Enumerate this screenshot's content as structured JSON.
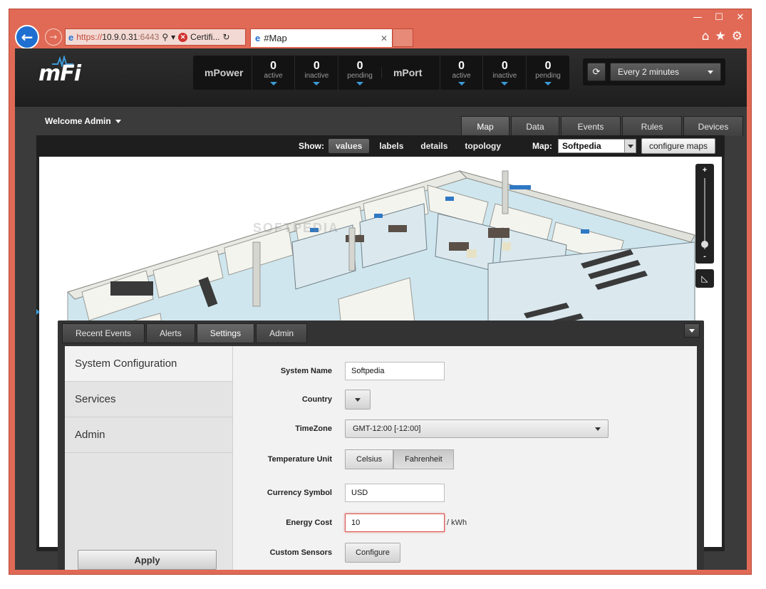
{
  "window": {
    "controls": [
      "—",
      "☐",
      "✕"
    ]
  },
  "browser": {
    "back_icon": "←",
    "forward_icon": "→",
    "address": {
      "ie_icon": "e",
      "url_https": "https://",
      "url_main": "10.9.0.31",
      "url_port": ":6443",
      "search_icon": "⚲",
      "dropdown_icon": "▾",
      "cert_icon": "✕",
      "cert_text": "Certifi...",
      "reload_icon": "↻"
    },
    "tab": {
      "ie_icon": "e",
      "title": "#Map",
      "close": "✕"
    },
    "tools": {
      "home": "⌂",
      "favorites": "★",
      "settings": "⚙"
    }
  },
  "header": {
    "logo": "mFi",
    "mpower": {
      "title": "mPower",
      "stats": [
        {
          "value": "0",
          "label": "active"
        },
        {
          "value": "0",
          "label": "inactive"
        },
        {
          "value": "0",
          "label": "pending"
        }
      ]
    },
    "mport": {
      "title": "mPort",
      "stats": [
        {
          "value": "0",
          "label": "active"
        },
        {
          "value": "0",
          "label": "inactive"
        },
        {
          "value": "0",
          "label": "pending"
        }
      ]
    },
    "refresh_icon": "⟳",
    "refresh_interval": "Every 2 minutes"
  },
  "welcome": "Welcome Admin",
  "nav_tabs": [
    "Map",
    "Data",
    "Events",
    "Rules",
    "Devices"
  ],
  "map_toolbar": {
    "show_label": "Show:",
    "show_options": [
      "values",
      "labels",
      "details",
      "topology"
    ],
    "map_label": "Map:",
    "map_selected": "Softpedia",
    "configure_maps": "configure maps"
  },
  "zoom": {
    "plus": "+",
    "minus": "-",
    "measure_icon": "◺"
  },
  "panel": {
    "tabs": [
      "Recent Events",
      "Alerts",
      "Settings",
      "Admin"
    ],
    "side_menu": [
      "System Configuration",
      "Services",
      "Admin"
    ],
    "apply": "Apply",
    "form": {
      "system_name_label": "System Name",
      "system_name_value": "Softpedia",
      "country_label": "Country",
      "timezone_label": "TimeZone",
      "timezone_value": "GMT-12:00 [-12:00]",
      "temp_unit_label": "Temperature Unit",
      "temp_celsius": "Celsius",
      "temp_fahrenheit": "Fahrenheit",
      "currency_label": "Currency Symbol",
      "currency_value": "USD",
      "energy_cost_label": "Energy Cost",
      "energy_cost_value": "10",
      "energy_cost_unit": "/ kWh",
      "custom_sensors_label": "Custom Sensors",
      "custom_sensors_button": "Configure"
    },
    "watermark": "SOFTPEDIA"
  },
  "colors": {
    "window_frame": "#e06a55",
    "accent_blue": "#3b9bd8",
    "header_bg": "#2e2e2e"
  }
}
